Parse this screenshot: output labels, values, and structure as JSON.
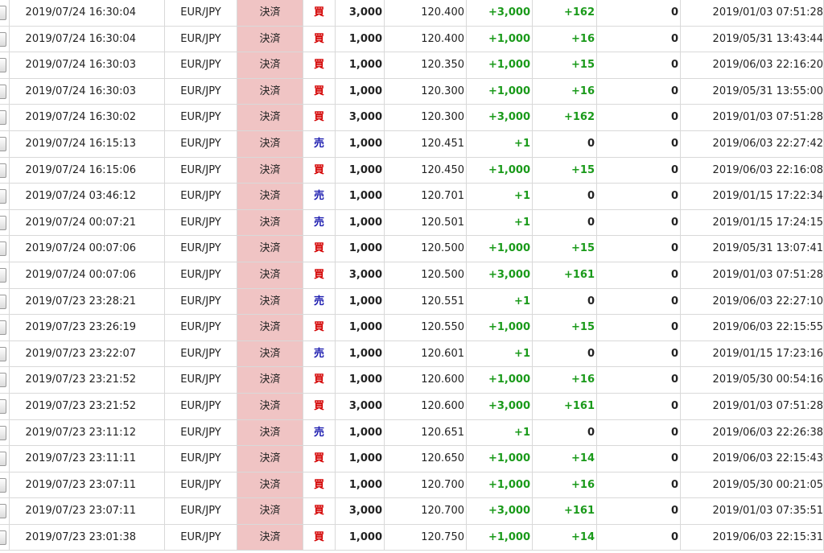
{
  "rows": [
    {
      "time": "2019/07/24 16:30:04",
      "pair": "EUR/JPY",
      "type": "決済",
      "side": "買",
      "side_kind": "buy",
      "qty": "3,000",
      "price": "120.400",
      "pips": "+3,000",
      "pl": "+162",
      "swap": "0",
      "open": "2019/01/03 07:51:28"
    },
    {
      "time": "2019/07/24 16:30:04",
      "pair": "EUR/JPY",
      "type": "決済",
      "side": "買",
      "side_kind": "buy",
      "qty": "1,000",
      "price": "120.400",
      "pips": "+1,000",
      "pl": "+16",
      "swap": "0",
      "open": "2019/05/31 13:43:44"
    },
    {
      "time": "2019/07/24 16:30:03",
      "pair": "EUR/JPY",
      "type": "決済",
      "side": "買",
      "side_kind": "buy",
      "qty": "1,000",
      "price": "120.350",
      "pips": "+1,000",
      "pl": "+15",
      "swap": "0",
      "open": "2019/06/03 22:16:20"
    },
    {
      "time": "2019/07/24 16:30:03",
      "pair": "EUR/JPY",
      "type": "決済",
      "side": "買",
      "side_kind": "buy",
      "qty": "1,000",
      "price": "120.300",
      "pips": "+1,000",
      "pl": "+16",
      "swap": "0",
      "open": "2019/05/31 13:55:00"
    },
    {
      "time": "2019/07/24 16:30:02",
      "pair": "EUR/JPY",
      "type": "決済",
      "side": "買",
      "side_kind": "buy",
      "qty": "3,000",
      "price": "120.300",
      "pips": "+3,000",
      "pl": "+162",
      "swap": "0",
      "open": "2019/01/03 07:51:28"
    },
    {
      "time": "2019/07/24 16:15:13",
      "pair": "EUR/JPY",
      "type": "決済",
      "side": "売",
      "side_kind": "sell",
      "qty": "1,000",
      "price": "120.451",
      "pips": "+1",
      "pl": "0",
      "swap": "0",
      "open": "2019/06/03 22:27:42"
    },
    {
      "time": "2019/07/24 16:15:06",
      "pair": "EUR/JPY",
      "type": "決済",
      "side": "買",
      "side_kind": "buy",
      "qty": "1,000",
      "price": "120.450",
      "pips": "+1,000",
      "pl": "+15",
      "swap": "0",
      "open": "2019/06/03 22:16:08"
    },
    {
      "time": "2019/07/24 03:46:12",
      "pair": "EUR/JPY",
      "type": "決済",
      "side": "売",
      "side_kind": "sell",
      "qty": "1,000",
      "price": "120.701",
      "pips": "+1",
      "pl": "0",
      "swap": "0",
      "open": "2019/01/15 17:22:34"
    },
    {
      "time": "2019/07/24 00:07:21",
      "pair": "EUR/JPY",
      "type": "決済",
      "side": "売",
      "side_kind": "sell",
      "qty": "1,000",
      "price": "120.501",
      "pips": "+1",
      "pl": "0",
      "swap": "0",
      "open": "2019/01/15 17:24:15"
    },
    {
      "time": "2019/07/24 00:07:06",
      "pair": "EUR/JPY",
      "type": "決済",
      "side": "買",
      "side_kind": "buy",
      "qty": "1,000",
      "price": "120.500",
      "pips": "+1,000",
      "pl": "+15",
      "swap": "0",
      "open": "2019/05/31 13:07:41"
    },
    {
      "time": "2019/07/24 00:07:06",
      "pair": "EUR/JPY",
      "type": "決済",
      "side": "買",
      "side_kind": "buy",
      "qty": "3,000",
      "price": "120.500",
      "pips": "+3,000",
      "pl": "+161",
      "swap": "0",
      "open": "2019/01/03 07:51:28"
    },
    {
      "time": "2019/07/23 23:28:21",
      "pair": "EUR/JPY",
      "type": "決済",
      "side": "売",
      "side_kind": "sell",
      "qty": "1,000",
      "price": "120.551",
      "pips": "+1",
      "pl": "0",
      "swap": "0",
      "open": "2019/06/03 22:27:10"
    },
    {
      "time": "2019/07/23 23:26:19",
      "pair": "EUR/JPY",
      "type": "決済",
      "side": "買",
      "side_kind": "buy",
      "qty": "1,000",
      "price": "120.550",
      "pips": "+1,000",
      "pl": "+15",
      "swap": "0",
      "open": "2019/06/03 22:15:55"
    },
    {
      "time": "2019/07/23 23:22:07",
      "pair": "EUR/JPY",
      "type": "決済",
      "side": "売",
      "side_kind": "sell",
      "qty": "1,000",
      "price": "120.601",
      "pips": "+1",
      "pl": "0",
      "swap": "0",
      "open": "2019/01/15 17:23:16"
    },
    {
      "time": "2019/07/23 23:21:52",
      "pair": "EUR/JPY",
      "type": "決済",
      "side": "買",
      "side_kind": "buy",
      "qty": "1,000",
      "price": "120.600",
      "pips": "+1,000",
      "pl": "+16",
      "swap": "0",
      "open": "2019/05/30 00:54:16"
    },
    {
      "time": "2019/07/23 23:21:52",
      "pair": "EUR/JPY",
      "type": "決済",
      "side": "買",
      "side_kind": "buy",
      "qty": "3,000",
      "price": "120.600",
      "pips": "+3,000",
      "pl": "+161",
      "swap": "0",
      "open": "2019/01/03 07:51:28"
    },
    {
      "time": "2019/07/23 23:11:12",
      "pair": "EUR/JPY",
      "type": "決済",
      "side": "売",
      "side_kind": "sell",
      "qty": "1,000",
      "price": "120.651",
      "pips": "+1",
      "pl": "0",
      "swap": "0",
      "open": "2019/06/03 22:26:38"
    },
    {
      "time": "2019/07/23 23:11:11",
      "pair": "EUR/JPY",
      "type": "決済",
      "side": "買",
      "side_kind": "buy",
      "qty": "1,000",
      "price": "120.650",
      "pips": "+1,000",
      "pl": "+14",
      "swap": "0",
      "open": "2019/06/03 22:15:43"
    },
    {
      "time": "2019/07/23 23:07:11",
      "pair": "EUR/JPY",
      "type": "決済",
      "side": "買",
      "side_kind": "buy",
      "qty": "1,000",
      "price": "120.700",
      "pips": "+1,000",
      "pl": "+16",
      "swap": "0",
      "open": "2019/05/30 00:21:05"
    },
    {
      "time": "2019/07/23 23:07:11",
      "pair": "EUR/JPY",
      "type": "決済",
      "side": "買",
      "side_kind": "buy",
      "qty": "3,000",
      "price": "120.700",
      "pips": "+3,000",
      "pl": "+161",
      "swap": "0",
      "open": "2019/01/03 07:35:51"
    },
    {
      "time": "2019/07/23 23:01:38",
      "pair": "EUR/JPY",
      "type": "決済",
      "side": "買",
      "side_kind": "buy",
      "qty": "1,000",
      "price": "120.750",
      "pips": "+1,000",
      "pl": "+14",
      "swap": "0",
      "open": "2019/06/03 22:15:31"
    }
  ],
  "colors": {
    "type_cell_bg": "#f0c4c4",
    "buy": "#d40000",
    "sell": "#1f1fb0",
    "positive": "#1a9a1a"
  }
}
